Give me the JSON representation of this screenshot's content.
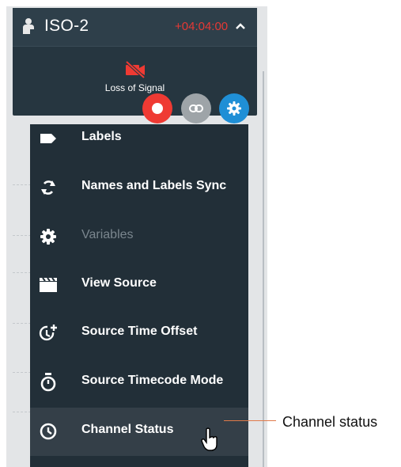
{
  "channel": {
    "title": "ISO-2",
    "time_offset": "+04:04:00",
    "signal_status": "Loss of Signal"
  },
  "menu": {
    "items": [
      {
        "label": "Labels",
        "icon": "label-icon",
        "enabled": true
      },
      {
        "label": "Names and Labels Sync",
        "icon": "sync-icon",
        "enabled": true
      },
      {
        "label": "Variables",
        "icon": "gear-icon",
        "enabled": false
      },
      {
        "label": "View Source",
        "icon": "clapperboard-icon",
        "enabled": true
      },
      {
        "label": "Source Time Offset",
        "icon": "clock-plus-icon",
        "enabled": true
      },
      {
        "label": "Source Timecode Mode",
        "icon": "stopwatch-icon",
        "enabled": true
      },
      {
        "label": "Channel Status",
        "icon": "clock-icon",
        "enabled": true,
        "hovered": true
      }
    ]
  },
  "callout": {
    "text": "Channel status"
  },
  "colors": {
    "record": "#ef3a33",
    "link": "#9ea4a8",
    "settings": "#1f8fd6",
    "offset": "#e53935",
    "menu_bg": "#222f38"
  }
}
